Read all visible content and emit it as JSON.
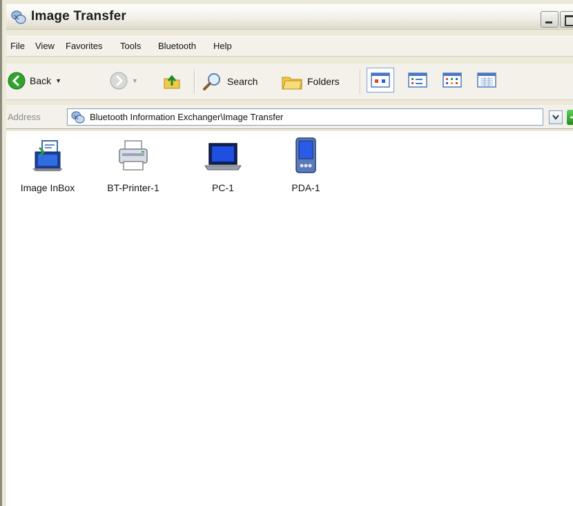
{
  "window": {
    "title": "Image Transfer",
    "title_icon": "bluetooth-exchanger-icon"
  },
  "menu": {
    "items": [
      {
        "label": "File"
      },
      {
        "label": "View"
      },
      {
        "label": "Favorites"
      },
      {
        "label": "Tools"
      },
      {
        "label": "Bluetooth"
      },
      {
        "label": "Help"
      }
    ]
  },
  "toolbar": {
    "back_label": "Back",
    "search_label": "Search",
    "folders_label": "Folders",
    "views": [
      {
        "icon": "view-tiles-icon",
        "active": true
      },
      {
        "icon": "view-icons-icon",
        "active": false
      },
      {
        "icon": "view-list-icon",
        "active": false
      },
      {
        "icon": "view-details-icon",
        "active": false
      }
    ]
  },
  "address": {
    "label": "Address",
    "value": "Bluetooth Information Exchanger\\Image Transfer"
  },
  "items": [
    {
      "label": "Image InBox",
      "icon": "inbox-icon"
    },
    {
      "label": "BT-Printer-1",
      "icon": "printer-icon"
    },
    {
      "label": "PC-1",
      "icon": "laptop-icon"
    },
    {
      "label": "PDA-1",
      "icon": "pda-icon"
    }
  ],
  "colors": {
    "chrome": "#ece9d8",
    "address_border": "#7f9db9",
    "go_green": "#2ea02e",
    "back_green": "#2fa52f"
  }
}
